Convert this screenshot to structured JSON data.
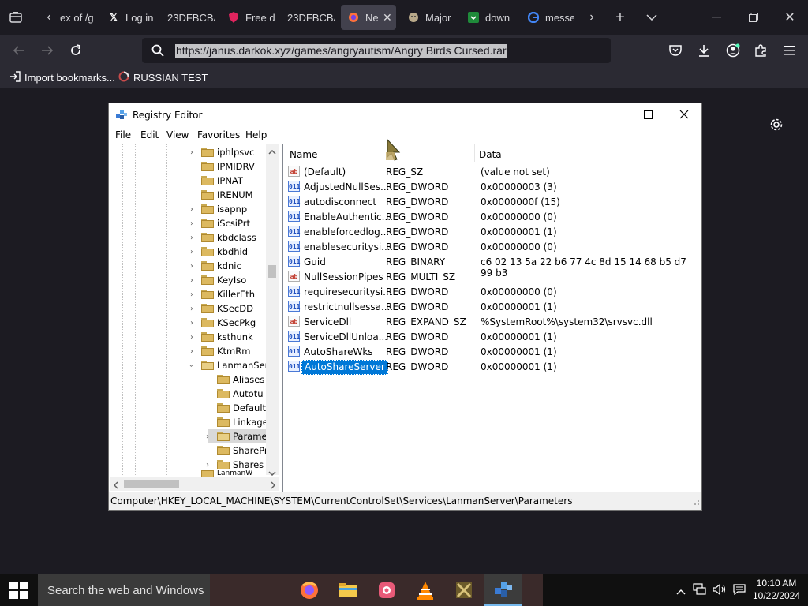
{
  "browser": {
    "tabs": [
      {
        "label": "ex of /g"
      },
      {
        "label": "Log in"
      },
      {
        "label": "23DFBCBA"
      },
      {
        "label": "Free d"
      },
      {
        "label": "23DFBCBA"
      },
      {
        "label": "Ne"
      },
      {
        "label": "Major"
      },
      {
        "label": "downl"
      },
      {
        "label": "messe"
      }
    ],
    "url": "https://janus.darkok.xyz/games/angryautism/Angry Birds Cursed.rar",
    "bookmarks": {
      "import_label": "Import bookmarks...",
      "item": "RUSSIAN TEST"
    }
  },
  "regedit": {
    "title": "Registry Editor",
    "menu": [
      "File",
      "Edit",
      "View",
      "Favorites",
      "Help"
    ],
    "tree": [
      {
        "label": "iphlpsvc"
      },
      {
        "label": "IPMIDRV"
      },
      {
        "label": "IPNAT"
      },
      {
        "label": "IRENUM"
      },
      {
        "label": "isapnp"
      },
      {
        "label": "iScsiPrt"
      },
      {
        "label": "kbdclass"
      },
      {
        "label": "kbdhid"
      },
      {
        "label": "kdnic"
      },
      {
        "label": "KeyIso"
      },
      {
        "label": "KillerEth"
      },
      {
        "label": "KSecDD"
      },
      {
        "label": "KSecPkg"
      },
      {
        "label": "ksthunk"
      },
      {
        "label": "KtmRm"
      },
      {
        "label": "LanmanSer"
      },
      {
        "label": "Aliases"
      },
      {
        "label": "Autotu"
      },
      {
        "label": "Default"
      },
      {
        "label": "Linkage"
      },
      {
        "label": "Parame"
      },
      {
        "label": "SharePr"
      },
      {
        "label": "Shares"
      },
      {
        "label": "LanmanW"
      }
    ],
    "columns": {
      "name": "Name",
      "type": "Type",
      "data": "Data"
    },
    "values": [
      {
        "name": "(Default)",
        "type": "REG_SZ",
        "data": "(value not set)",
        "icon": "ab"
      },
      {
        "name": "AdjustedNullSes...",
        "type": "REG_DWORD",
        "data": "0x00000003 (3)",
        "icon": "bin"
      },
      {
        "name": "autodisconnect",
        "type": "REG_DWORD",
        "data": "0x0000000f (15)",
        "icon": "bin"
      },
      {
        "name": "EnableAuthentic...",
        "type": "REG_DWORD",
        "data": "0x00000000 (0)",
        "icon": "bin"
      },
      {
        "name": "enableforcedlog...",
        "type": "REG_DWORD",
        "data": "0x00000001 (1)",
        "icon": "bin"
      },
      {
        "name": "enablesecuritysi...",
        "type": "REG_DWORD",
        "data": "0x00000000 (0)",
        "icon": "bin"
      },
      {
        "name": "Guid",
        "type": "REG_BINARY",
        "data": "c6 02 13 5a 22 b6 77 4c 8d 15 14 68 b5 d7 99 b3",
        "icon": "bin"
      },
      {
        "name": "NullSessionPipes",
        "type": "REG_MULTI_SZ",
        "data": "",
        "icon": "ab"
      },
      {
        "name": "requiresecuritysi...",
        "type": "REG_DWORD",
        "data": "0x00000000 (0)",
        "icon": "bin"
      },
      {
        "name": "restrictnullsessa...",
        "type": "REG_DWORD",
        "data": "0x00000001 (1)",
        "icon": "bin"
      },
      {
        "name": "ServiceDll",
        "type": "REG_EXPAND_SZ",
        "data": "%SystemRoot%\\system32\\srvsvc.dll",
        "icon": "ab"
      },
      {
        "name": "ServiceDllUnloa...",
        "type": "REG_DWORD",
        "data": "0x00000001 (1)",
        "icon": "bin"
      },
      {
        "name": "AutoShareWks",
        "type": "REG_DWORD",
        "data": "0x00000001 (1)",
        "icon": "bin"
      },
      {
        "name": "AutoShareServer",
        "type": "REG_DWORD",
        "data": "0x00000001 (1)",
        "icon": "bin"
      }
    ],
    "status_path": "Computer\\HKEY_LOCAL_MACHINE\\SYSTEM\\CurrentControlSet\\Services\\LanmanServer\\Parameters"
  },
  "taskbar": {
    "search_placeholder": "Search the web and Windows",
    "time": "10:10 AM",
    "date": "10/22/2024"
  },
  "colors": {
    "selection": "#0078d7",
    "browser_dark": "#1c1b22",
    "toolbar": "#2b2a33"
  }
}
